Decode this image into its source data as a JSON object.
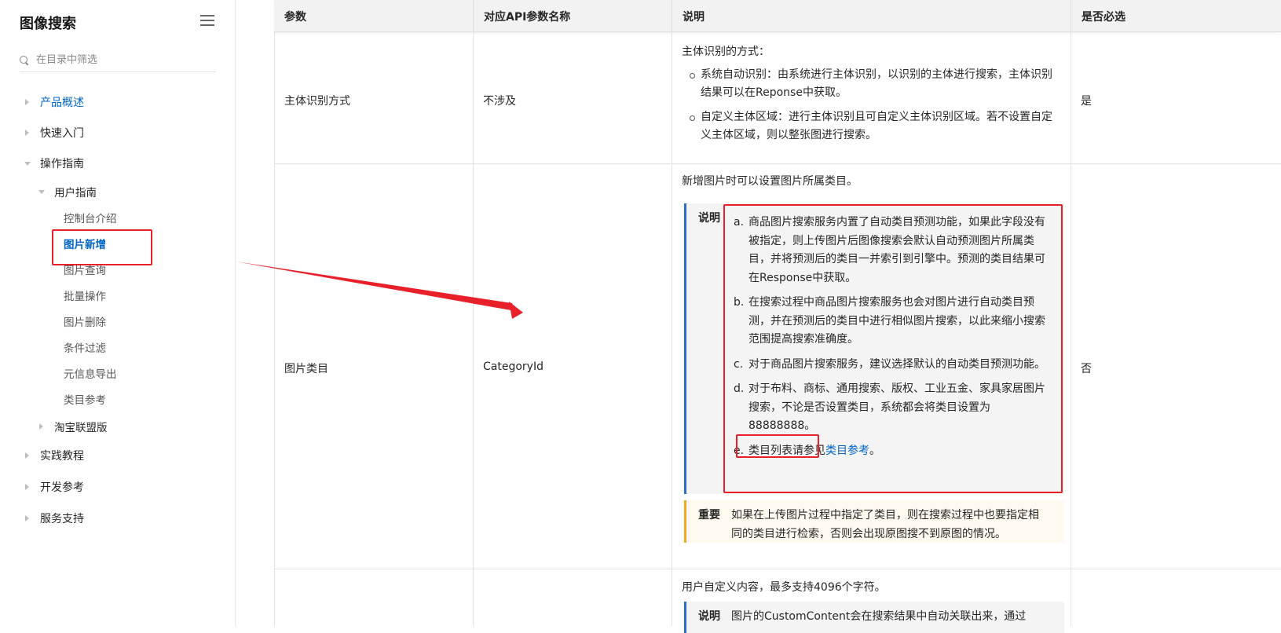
{
  "sidebar": {
    "title": "图像搜索",
    "search_placeholder": "在目录中筛选",
    "items": [
      {
        "label": "产品概述"
      },
      {
        "label": "快速入门"
      },
      {
        "label": "操作指南"
      },
      {
        "label": "用户指南"
      },
      {
        "label": "控制台介绍"
      },
      {
        "label": "图片新增"
      },
      {
        "label": "图片查询"
      },
      {
        "label": "批量操作"
      },
      {
        "label": "图片删除"
      },
      {
        "label": "条件过滤"
      },
      {
        "label": "元信息导出"
      },
      {
        "label": "类目参考"
      },
      {
        "label": "淘宝联盟版"
      },
      {
        "label": "实践教程"
      },
      {
        "label": "开发参考"
      },
      {
        "label": "服务支持"
      }
    ]
  },
  "table": {
    "headers": [
      "参数",
      "对应API参数名称",
      "说明",
      "是否必选"
    ],
    "row1": {
      "param": "主体识别方式",
      "api": "不涉及",
      "desc_intro": "主体识别的方式：",
      "desc_bullets": [
        "系统自动识别：由系统进行主体识别，以识别的主体进行搜索，主体识别结果可以在Reponse中获取。",
        "自定义主体区域：进行主体识别且可自定义主体识别区域。若不设置自定义主体区域，则以整张图进行搜索。"
      ],
      "required": "是"
    },
    "row2": {
      "param": "图片类目",
      "api": "CategoryId",
      "desc_intro": "新增图片时可以设置图片所属类目。",
      "note_label": "说明",
      "note_items": [
        {
          "marker": "a.",
          "text": "商品图片搜索服务内置了自动类目预测功能，如果此字段没有被指定，则上传图片后图像搜索会默认自动预测图片所属类目，并将预测后的类目一并索引到引擎中。预测的类目结果可在Response中获取。"
        },
        {
          "marker": "b.",
          "text": "在搜索过程中商品图片搜索服务也会对图片进行自动类目预测，并在预测后的类目中进行相似图片搜索，以此来缩小搜索范围提高搜索准确度。"
        },
        {
          "marker": "c.",
          "text": "对于商品图片搜索服务，建议选择默认的自动类目预测功能。"
        },
        {
          "marker": "d.",
          "text": "对于布料、商标、通用搜索、版权、工业五金、家具家居图片搜索，不论是否设置类目，系统都会将类目设置为"
        },
        {
          "marker": "e.",
          "text": "类目列表请参见"
        }
      ],
      "item_d_value": "88888888。",
      "item_e_link": "类目参考",
      "item_e_tail": "。",
      "important_label": "重要",
      "important_text": "如果在上传图片过程中指定了类目，则在搜索过程中也要指定相同的类目进行检索，否则会出现原图搜不到原图的情况。",
      "required": "否"
    },
    "row3": {
      "desc_intro": "用户自定义内容，最多支持4096个字符。",
      "note_label": "说明",
      "note_text": "图片的CustomContent会在搜索结果中自动关联出来，通过"
    }
  },
  "colors": {
    "accent": "#0064c8",
    "highlight": "#e8202a",
    "note_border": "#2a70c8",
    "important_border": "#f5a623"
  }
}
